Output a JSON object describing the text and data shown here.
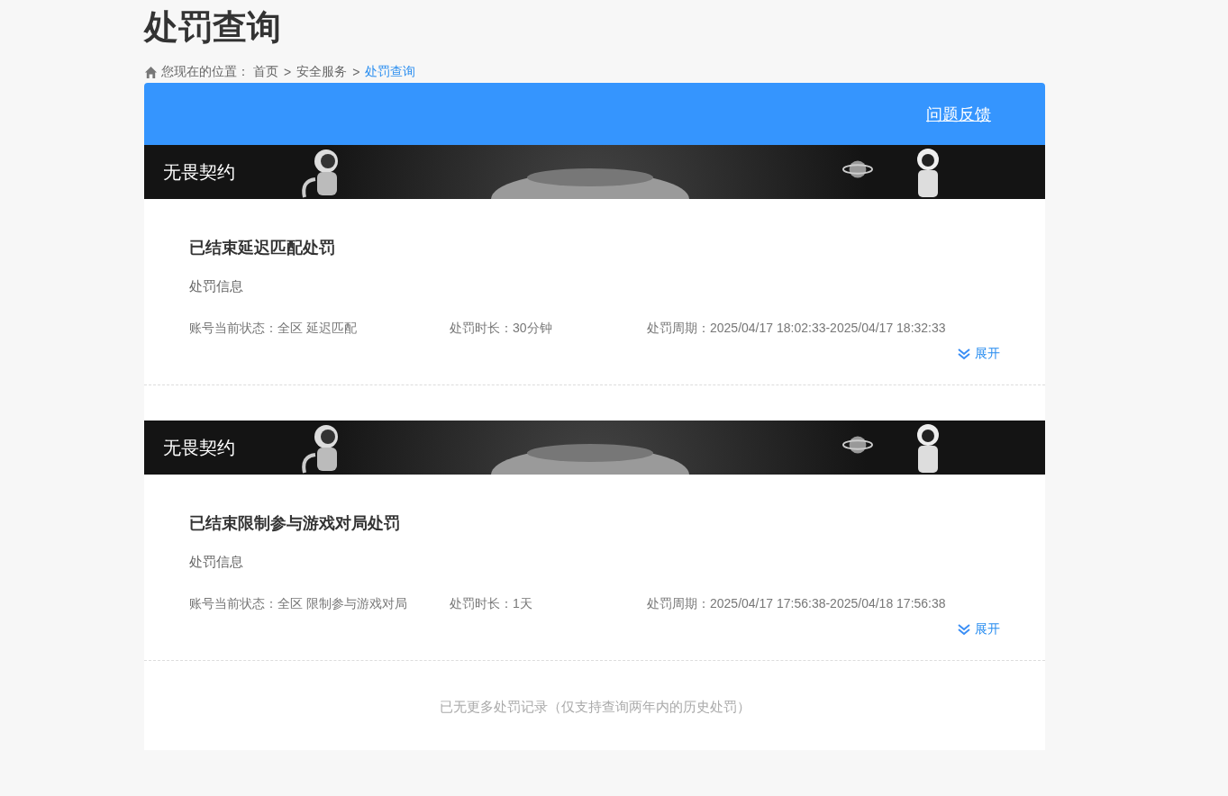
{
  "page_title": "处罚查询",
  "breadcrumb": {
    "prefix": "您现在的位置：",
    "items": [
      {
        "label": "首页",
        "current": false
      },
      {
        "label": "安全服务",
        "current": false
      },
      {
        "label": "处罚查询",
        "current": true
      }
    ],
    "separator": ">"
  },
  "header_bar": {
    "link": "问题反馈"
  },
  "records": [
    {
      "game": "无畏契约",
      "title": "已结束延迟匹配处罚",
      "info_label": "处罚信息",
      "status": "账号当前状态：全区 延迟匹配",
      "duration": "处罚时长：30分钟",
      "period": "处罚周期：2025/04/17 18:02:33-2025/04/17 18:32:33",
      "toggle": "展开",
      "expanded": false
    },
    {
      "game": "无畏契约",
      "title": "已结束限制参与游戏对局处罚",
      "info_label": "处罚信息",
      "status": "账号当前状态：全区 限制参与游戏对局",
      "duration": "处罚时长：1天",
      "period": "处罚周期：2025/04/17 17:56:38-2025/04/18 17:56:38",
      "toggle": "展开",
      "expanded": false
    }
  ],
  "footer_note": "已无更多处罚记录（仅支持查询两年内的历史处罚）"
}
